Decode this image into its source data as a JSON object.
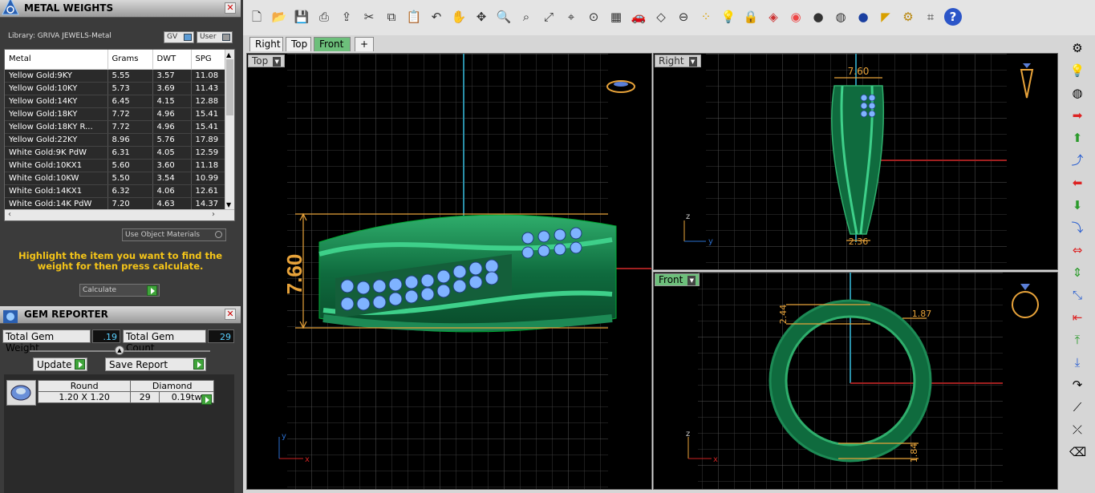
{
  "metal_panel": {
    "title": "METAL WEIGHTS",
    "library": "Library: GRIVA JEWELS-Metal",
    "gv_label": "GV",
    "user_label": "User",
    "columns": [
      "Metal",
      "Grams",
      "DWT",
      "SPG"
    ],
    "rows": [
      [
        "Yellow Gold:9KY",
        "5.55",
        "3.57",
        "11.08"
      ],
      [
        "Yellow Gold:10KY",
        "5.73",
        "3.69",
        "11.43"
      ],
      [
        "Yellow Gold:14KY",
        "6.45",
        "4.15",
        "12.88"
      ],
      [
        "Yellow Gold:18KY",
        "7.72",
        "4.96",
        "15.41"
      ],
      [
        "Yellow Gold:18KY R...",
        "7.72",
        "4.96",
        "15.41"
      ],
      [
        "Yellow Gold:22KY",
        "8.96",
        "5.76",
        "17.89"
      ],
      [
        "White Gold:9K PdW",
        "6.31",
        "4.05",
        "12.59"
      ],
      [
        "White Gold:10KX1",
        "5.60",
        "3.60",
        "11.18"
      ],
      [
        "White Gold:10KW",
        "5.50",
        "3.54",
        "10.99"
      ],
      [
        "White Gold:14KX1",
        "6.32",
        "4.06",
        "12.61"
      ],
      [
        "White Gold:14K PdW",
        "7.20",
        "4.63",
        "14.37"
      ]
    ],
    "use_object_materials": "Use Object Materials",
    "hint": "Highlight the item you want to find the weight for then press calculate.",
    "calculate": "Calculate"
  },
  "gem_panel": {
    "title": "GEM REPORTER",
    "total_weight_label": "Total Gem Weight",
    "total_weight": ".19",
    "total_count_label": "Total Gem Count",
    "total_count": "29",
    "update": "Update",
    "save_report": "Save Report",
    "gem": {
      "shape": "Round",
      "size": "1.20 X 1.20",
      "material": "Diamond",
      "count": "29",
      "weight": "0.19tw"
    }
  },
  "view_tabs": [
    "Right",
    "Top",
    "Front",
    "+"
  ],
  "viewports": {
    "top": {
      "label": "Top",
      "dim": "7.60"
    },
    "right": {
      "label": "Right",
      "dim_top": "7.60",
      "dim_bottom": "2.36"
    },
    "front": {
      "label": "Front",
      "dim_left": "2.44",
      "dim_right": "1.87",
      "dim_bottom": "1.84"
    }
  },
  "axes": {
    "x": "x",
    "y": "y",
    "z": "z"
  }
}
